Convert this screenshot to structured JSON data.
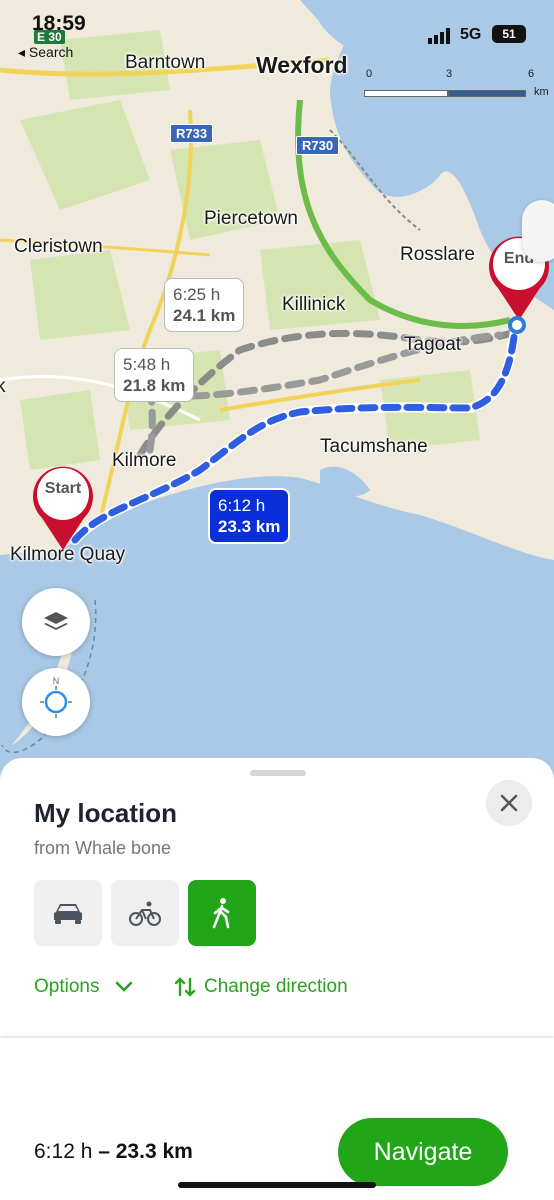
{
  "status_bar": {
    "time": "18:59",
    "back_label": "◂ Search",
    "road_sign": "E 30",
    "network": "5G",
    "battery": "51"
  },
  "map": {
    "places": [
      {
        "name": "Barntown"
      },
      {
        "name": "Wexford"
      },
      {
        "name": "Piercetown"
      },
      {
        "name": "Cleristown"
      },
      {
        "name": "Rosslare"
      },
      {
        "name": "Killinick"
      },
      {
        "name": "Tagoat"
      },
      {
        "name": "Tacumshane"
      },
      {
        "name": "Kilmore"
      },
      {
        "name": "Kilmore Quay"
      },
      {
        "name": "k"
      }
    ],
    "roads": [
      "R733",
      "R730"
    ],
    "scale": {
      "ticks": [
        "0",
        "3",
        "6"
      ],
      "unit": "km"
    },
    "routes": [
      {
        "time": "6:25 h",
        "distance": "24.1 km",
        "selected": false
      },
      {
        "time": "5:48 h",
        "distance": "21.8 km",
        "selected": false
      },
      {
        "time": "6:12 h",
        "distance": "23.3 km",
        "selected": true
      }
    ],
    "start_label": "Start",
    "end_label": "End",
    "compass_label": "N"
  },
  "sheet": {
    "title": "My location",
    "subtitle": "from Whale bone",
    "modes": [
      {
        "name": "car",
        "active": false
      },
      {
        "name": "bicycle",
        "active": false
      },
      {
        "name": "walk",
        "active": true
      }
    ],
    "options_label": "Options",
    "change_direction_label": "Change direction",
    "summary_time": "6:12 h",
    "summary_dash": " – ",
    "summary_distance": "23.3 km",
    "navigate_label": "Navigate"
  },
  "colors": {
    "accent": "#22a519",
    "route_selected": "#0a2fd8",
    "route_alt": "#888888",
    "sea": "#a9c9e6",
    "land": "#efeadc"
  }
}
